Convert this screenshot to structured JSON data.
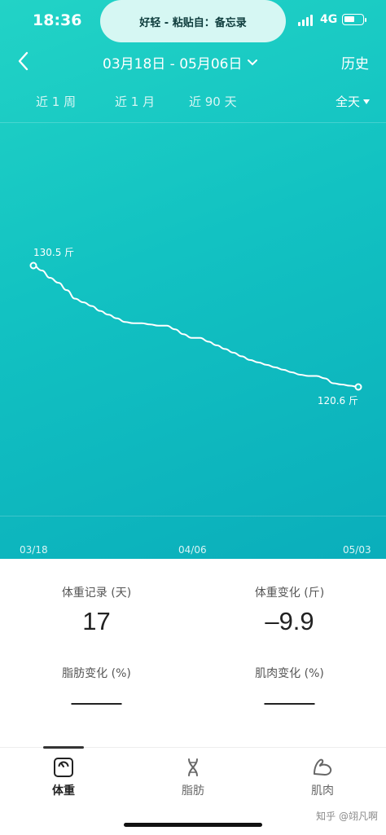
{
  "status_bar": {
    "time": "18:36",
    "notification": "好轻 - 粘贴自：备忘录",
    "network": "4G"
  },
  "header": {
    "date_range": "03月18日 - 05月06日",
    "history": "历史"
  },
  "range_tabs": [
    "近 1 周",
    "近 1 月",
    "近 90 天"
  ],
  "time_filter": "全天",
  "chart_data": {
    "type": "line",
    "series": [
      {
        "values": [
          130.5,
          130.1,
          129.5,
          129.1,
          128.5,
          127.8,
          127.5,
          127.2,
          126.8,
          126.5,
          126.2,
          125.9,
          125.8,
          125.8,
          125.7,
          125.6,
          125.6,
          125.3,
          124.9,
          124.6,
          124.6,
          124.3,
          124.0,
          123.7,
          123.4,
          123.1,
          122.8,
          122.6,
          122.4,
          122.2,
          122.0,
          121.8,
          121.6,
          121.5,
          121.5,
          121.3,
          120.9,
          120.8,
          120.7,
          120.6
        ]
      }
    ],
    "start_label": "130.5 斤",
    "end_label": "120.6 斤",
    "x_ticks": [
      "03/18",
      "04/06",
      "05/03"
    ],
    "ylim": [
      115,
      135
    ]
  },
  "stats": [
    {
      "label": "体重记录 (天)",
      "value": "17"
    },
    {
      "label": "体重变化 (斤)",
      "value": "–9.9"
    },
    {
      "label": "脂肪变化 (%)",
      "value": "——"
    },
    {
      "label": "肌肉变化 (%)",
      "value": "——"
    }
  ],
  "nav": [
    {
      "label": "体重",
      "icon": "scale-icon"
    },
    {
      "label": "脂肪",
      "icon": "dna-icon"
    },
    {
      "label": "肌肉",
      "icon": "muscle-icon"
    }
  ],
  "watermark": "知乎 @翊凡啊"
}
